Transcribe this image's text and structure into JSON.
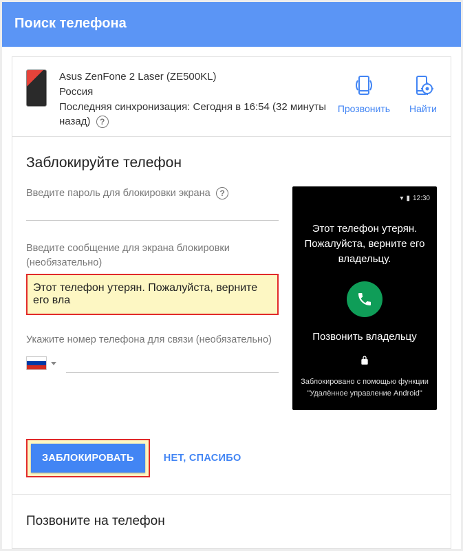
{
  "header": {
    "title": "Поиск телефона"
  },
  "device": {
    "name": "Asus ZenFone 2 Laser (ZE500KL)",
    "country": "Россия",
    "sync_prefix": "Последняя синхронизация: ",
    "sync_value": "Сегодня в 16:54 (32 минуты назад)"
  },
  "actions": {
    "ring": "Прозвонить",
    "find": "Найти"
  },
  "lock": {
    "title": "Заблокируйте телефон",
    "password_label": "Введите пароль для блокировки экрана",
    "message_label": "Введите сообщение для экрана блокировки (необязательно)",
    "message_value": "Этот телефон утерян. Пожалуйста, верните его вла",
    "phone_label": "Укажите номер телефона для связи (необязательно)",
    "lock_button": "ЗАБЛОКИРОВАТЬ",
    "skip_button": "НЕТ, СПАСИБО"
  },
  "preview": {
    "status_time": "12:30",
    "message": "Этот телефон утерян. Пожалуйста, верните его владельцу.",
    "call_label": "Позвонить владельцу",
    "locked_via": "Заблокировано с помощью функции",
    "locked_app": "\"Удалённое управление Android\""
  },
  "call_section": {
    "title": "Позвоните на телефон"
  }
}
